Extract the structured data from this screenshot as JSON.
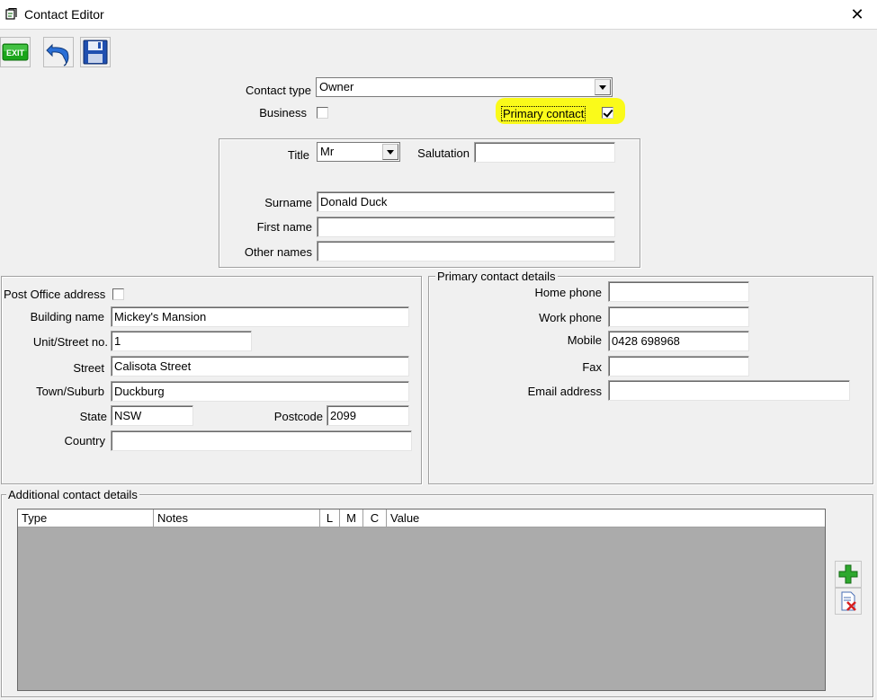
{
  "window": {
    "title": "Contact Editor",
    "close_glyph": "✕"
  },
  "toolbar": {
    "exit_icon": "exit-icon",
    "exit_label": "EXIT",
    "undo_icon": "undo-icon",
    "save_icon": "save-icon"
  },
  "top": {
    "contact_type_label": "Contact type",
    "contact_type_value": "Owner",
    "business_label": "Business",
    "business_checked": false,
    "primary_contact_label": "Primary contact",
    "primary_contact_checked": true,
    "highlight_color": "#fafa1a"
  },
  "name": {
    "title_label": "Title",
    "title_value": "Mr",
    "salutation_label": "Salutation",
    "salutation_value": "",
    "surname_label": "Surname",
    "surname_value": "Donald Duck",
    "first_name_label": "First name",
    "first_name_value": "",
    "other_names_label": "Other names",
    "other_names_value": ""
  },
  "address": {
    "po_label": "Post Office address",
    "po_checked": false,
    "building_label": "Building name",
    "building_value": "Mickey's Mansion",
    "unit_label": "Unit/Street no.",
    "unit_value": "1",
    "street_label": "Street",
    "street_value": "Calisota Street",
    "town_label": "Town/Suburb",
    "town_value": "Duckburg",
    "state_label": "State",
    "state_value": "NSW",
    "postcode_label": "Postcode",
    "postcode_value": "2099",
    "country_label": "Country",
    "country_value": ""
  },
  "primary_details": {
    "caption": "Primary contact details",
    "home_label": "Home phone",
    "home_value": "",
    "work_label": "Work phone",
    "work_value": "",
    "mobile_label": "Mobile",
    "mobile_value": "0428 698968",
    "fax_label": "Fax",
    "fax_value": "",
    "email_label": "Email address",
    "email_value": ""
  },
  "additional": {
    "caption": "Additional contact details",
    "columns": [
      "Type",
      "Notes",
      "L",
      "M",
      "C",
      "Value"
    ],
    "add_icon": "add-icon",
    "delete_icon": "delete-icon"
  }
}
